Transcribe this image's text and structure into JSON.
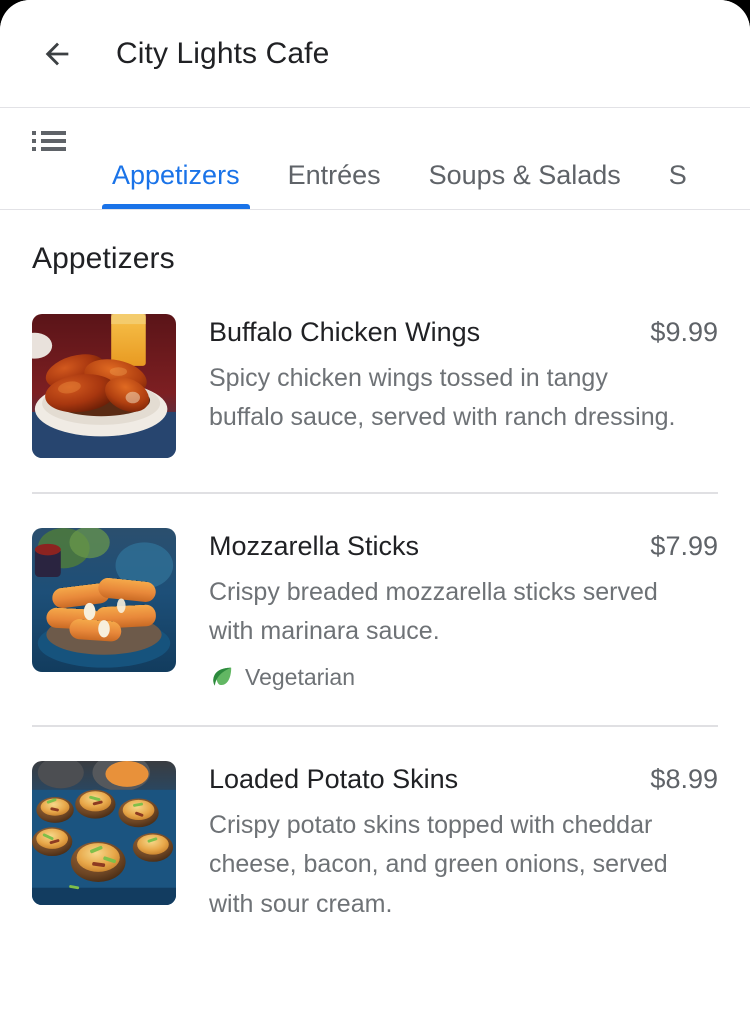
{
  "header": {
    "back_icon": "arrow-back-icon",
    "title": "City Lights Cafe"
  },
  "tabbar": {
    "list_icon": "list-view-icon",
    "tabs": [
      {
        "label": "Appetizers",
        "active": true
      },
      {
        "label": "Entrées",
        "active": false
      },
      {
        "label": "Soups & Salads",
        "active": false
      },
      {
        "label": "S",
        "active": false
      }
    ],
    "active_color": "#1a73e8",
    "inactive_color": "#5f6368"
  },
  "section": {
    "title": "Appetizers"
  },
  "menu_items": [
    {
      "name": "Buffalo Chicken Wings",
      "price": "$9.99",
      "description": "Spicy chicken wings tossed in tangy buffalo sauce, served with ranch dressing.",
      "image_alt": "buffalo-chicken-wings-photo",
      "tags": []
    },
    {
      "name": "Mozzarella Sticks",
      "price": "$7.99",
      "description": "Crispy breaded mozzarella sticks served with marinara sauce.",
      "image_alt": "mozzarella-sticks-photo",
      "tags": [
        {
          "label": "Vegetarian",
          "icon": "leaf-icon",
          "color": "#34a853"
        }
      ]
    },
    {
      "name": "Loaded Potato Skins",
      "price": "$8.99",
      "description": "Crispy potato skins topped with cheddar cheese, bacon, and green onions, served with sour cream.",
      "image_alt": "loaded-potato-skins-photo",
      "tags": []
    }
  ]
}
